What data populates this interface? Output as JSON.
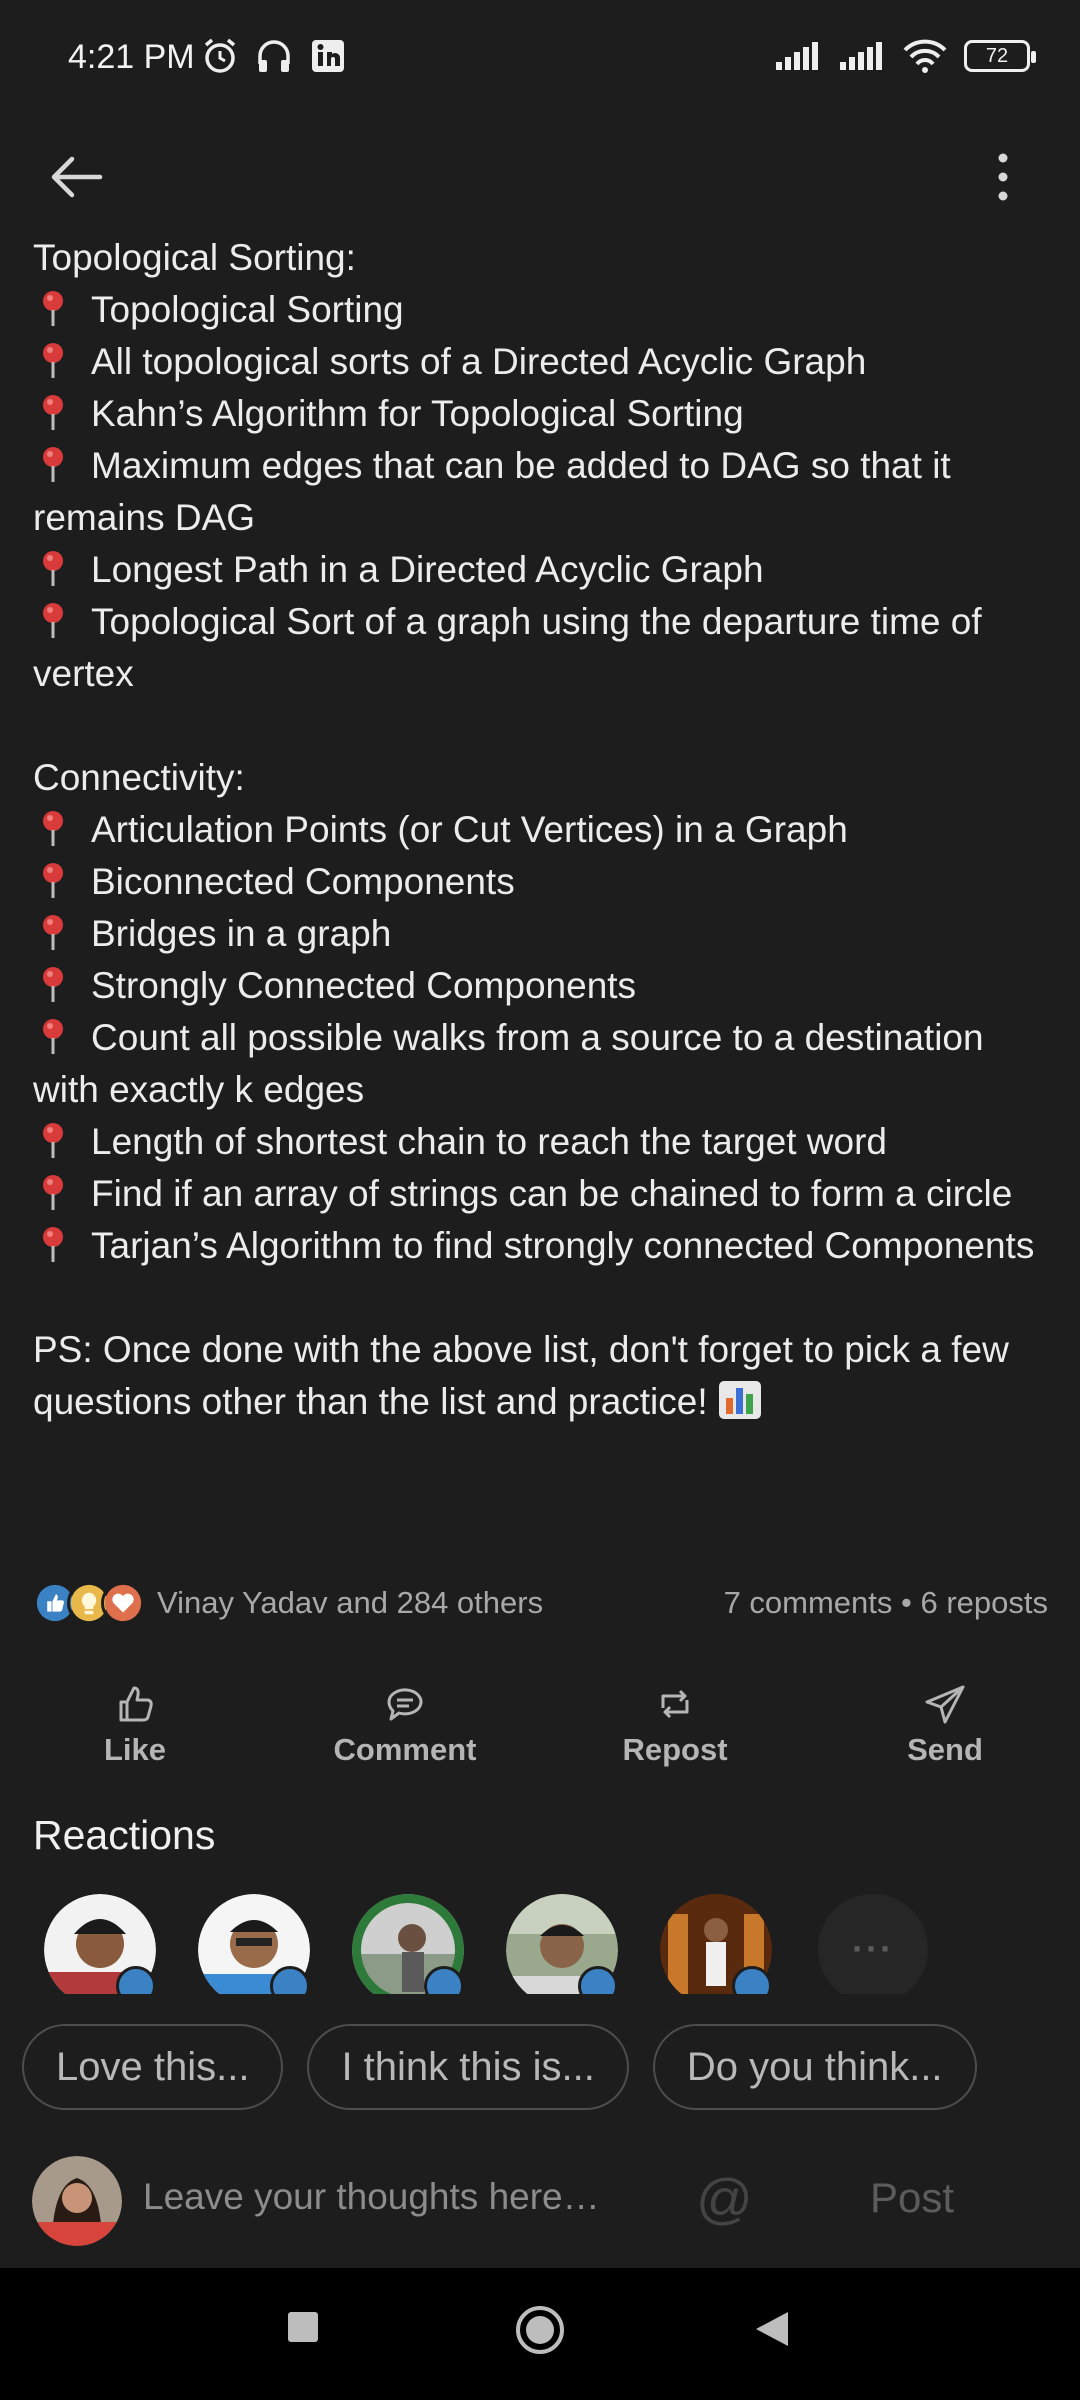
{
  "status_bar": {
    "time": "4:21 PM",
    "battery": "72",
    "left_icons": [
      "alarm-icon",
      "headphones-icon",
      "linkedin-icon"
    ],
    "right_icons": [
      "signal-icon",
      "signal-icon",
      "wifi-icon",
      "battery-icon"
    ]
  },
  "top_bar": {
    "back_icon": "arrow-left-icon",
    "more_icon": "more-vertical-icon"
  },
  "post": {
    "sections": [
      {
        "title": "Topological Sorting:",
        "items": [
          "Topological Sorting",
          "All topological sorts of a Directed Acyclic Graph",
          "Kahn’s Algorithm for Topological Sorting",
          "Maximum edges that can be added to DAG so that it remains DAG",
          "Longest Path in a Directed Acyclic Graph",
          "Topological Sort of a graph using the departure time of vertex"
        ]
      },
      {
        "title": "Connectivity:",
        "items": [
          "Articulation Points (or Cut Vertices) in a Graph",
          "Biconnected Components",
          "Bridges in a graph",
          "Strongly Connected Components",
          "Count all possible walks from a source to a destination with exactly k edges",
          "Length of shortest chain to reach the target word",
          "Find if an array of strings can be chained to form a circle",
          "Tarjan’s Algorithm to find strongly connected Components"
        ]
      }
    ],
    "closing": "PS: Once done with the above list, don't forget to pick a few questions other than the list and practice!"
  },
  "social": {
    "reactors": "Vinay Yadav and 284 others",
    "stats": "7 comments • 6 reposts",
    "reaction_icons": [
      "like-icon",
      "insightful-icon",
      "love-icon"
    ]
  },
  "actions": [
    {
      "label": "Like",
      "icon": "thumbs-up-icon"
    },
    {
      "label": "Comment",
      "icon": "comment-icon"
    },
    {
      "label": "Repost",
      "icon": "repost-icon"
    },
    {
      "label": "Send",
      "icon": "send-icon"
    }
  ],
  "reactions": {
    "title": "Reactions",
    "more": "···"
  },
  "quick_replies": [
    "Love this...",
    "I think this is...",
    "Do you think..."
  ],
  "composer": {
    "placeholder": "Leave your thoughts here…",
    "mention": "@",
    "post_label": "Post"
  },
  "nav": [
    "recents-button",
    "home-button",
    "back-button"
  ],
  "colors": {
    "background": "#1d1d1d",
    "text": "#ececec",
    "muted": "#a8a8a8",
    "pin_red": "#d93a3a",
    "like_blue": "#3b82c4"
  }
}
